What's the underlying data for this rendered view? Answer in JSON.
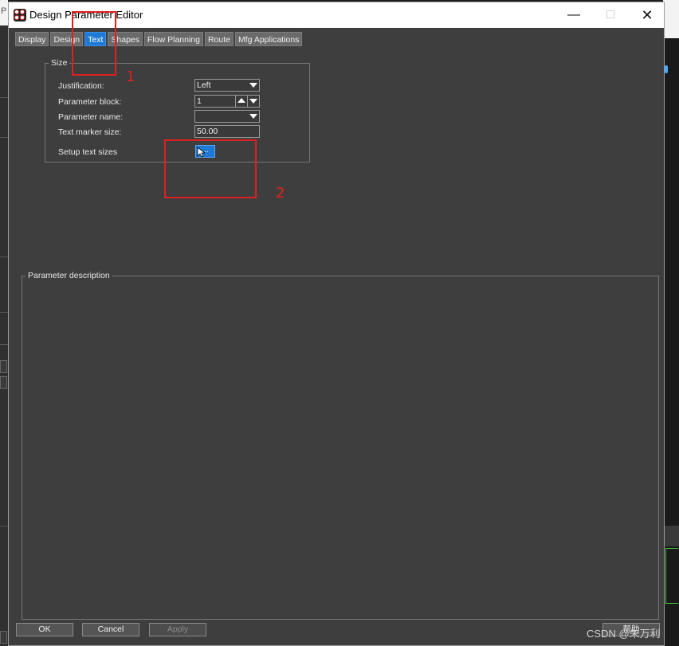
{
  "background": {
    "left_char": "P"
  },
  "window": {
    "title": "Design Parameter Editor",
    "min_label": "—",
    "max_label": "□",
    "close_label": "✕"
  },
  "tabs": [
    {
      "label": "Display",
      "active": false
    },
    {
      "label": "Design",
      "active": false
    },
    {
      "label": "Text",
      "active": true
    },
    {
      "label": "Shapes",
      "active": false
    },
    {
      "label": "Flow Planning",
      "active": false
    },
    {
      "label": "Route",
      "active": false
    },
    {
      "label": "Mfg Applications",
      "active": false
    }
  ],
  "size_group": {
    "legend": "Size",
    "justification_label": "Justification:",
    "justification_value": "Left",
    "parameter_block_label": "Parameter block:",
    "parameter_block_value": "1",
    "parameter_name_label": "Parameter name:",
    "parameter_name_value": "",
    "text_marker_size_label": "Text marker size:",
    "text_marker_size_value": "50.00",
    "setup_text_sizes_label": "Setup text sizes",
    "setup_button_label": "..."
  },
  "description_group": {
    "legend": "Parameter description"
  },
  "buttons": {
    "ok": "OK",
    "cancel": "Cancel",
    "apply": "Apply",
    "help": "帮助"
  },
  "annotations": {
    "marker_1": "1",
    "marker_2": "2",
    "color": "#e02020"
  },
  "watermark": "CSDN @朱万利",
  "colors": {
    "accent": "#1e7ad6",
    "dialog_bg": "#3e3e3e"
  }
}
